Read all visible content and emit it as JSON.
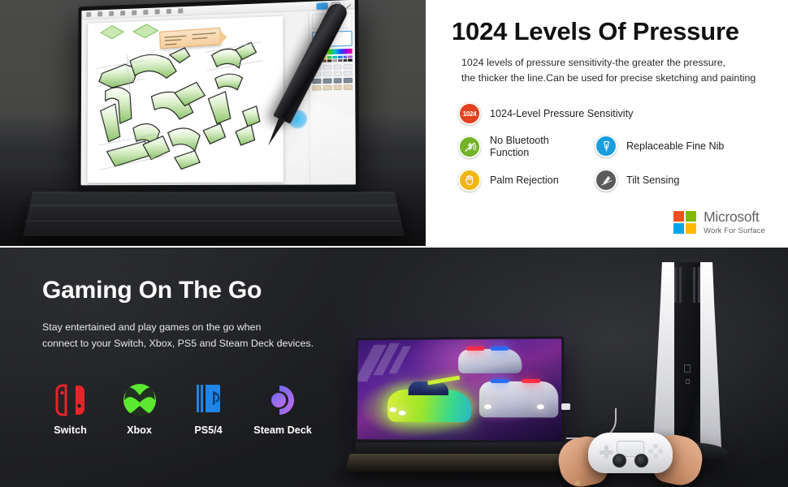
{
  "top_panel": {
    "headline": "1024 Levels Of Pressure",
    "subcopy_line1": "1024 levels of pressure sensitivity-the greater the pressure,",
    "subcopy_line2": "the thicker the line.Can be used for precise sketching and painting",
    "features": [
      {
        "icon": "pressure-1024-icon",
        "icon_text": "1024",
        "label": "1024-Level Pressure Sensitivity",
        "color": "#e2421f"
      },
      {
        "icon": "no-bluetooth-icon",
        "label_line1": "No Bluetooth",
        "label_line2": "Function",
        "color": "#74b227"
      },
      {
        "icon": "replaceable-nib-icon",
        "label": "Replaceable Fine Nib",
        "color": "#1b9ede"
      },
      {
        "icon": "palm-rejection-icon",
        "label": "Palm Rejection",
        "color": "#f2b613"
      },
      {
        "icon": "tilt-sensing-icon",
        "label": "Tilt Sensing",
        "color": "#5b5b5b"
      }
    ],
    "microsoft": {
      "name": "Microsoft",
      "tagline": "Work For Surface",
      "tile_colors": [
        "#f25022",
        "#7fba00",
        "#00a4ef",
        "#ffb900"
      ]
    }
  },
  "bottom_panel": {
    "title": "Gaming On The Go",
    "copy_line1": "Stay entertained and play games on the go when",
    "copy_line2": "connect to your Switch, Xbox, PS5 and Steam Deck devices.",
    "platforms": [
      {
        "name": "Switch",
        "icon": "nintendo-switch-icon",
        "color": "#e8232a"
      },
      {
        "name": "Xbox",
        "icon": "xbox-icon",
        "color": "#5ce831"
      },
      {
        "name": "PS5/4",
        "icon": "playstation-icon",
        "color": "#1f85e8"
      },
      {
        "name": "Steam Deck",
        "icon": "steam-deck-icon",
        "color": "#9b6de8"
      }
    ],
    "scene": {
      "monitor": "portable-monitor-racing-game",
      "console": "ps5-console",
      "controller": "dualsense-controller"
    }
  },
  "top_photo": {
    "scene": "tablet-with-stylus-drawing-app",
    "artwork": "green-3d-arrow-sketches"
  }
}
